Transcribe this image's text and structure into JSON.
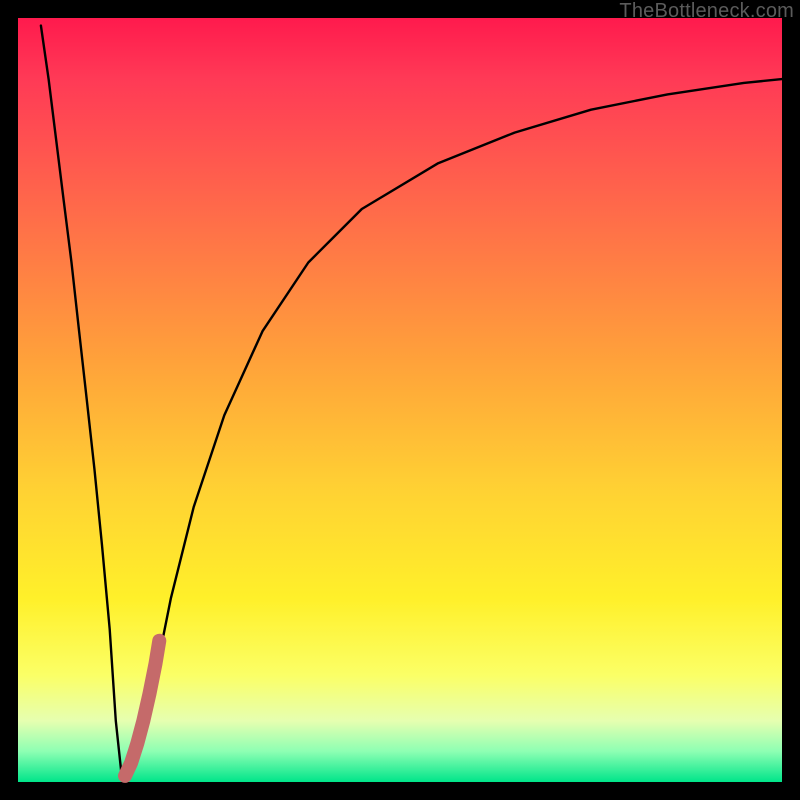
{
  "watermark": "TheBottleneck.com",
  "chart_data": {
    "type": "line",
    "title": "",
    "xlabel": "",
    "ylabel": "",
    "xlim": [
      0,
      100
    ],
    "ylim": [
      0,
      100
    ],
    "series": [
      {
        "name": "bottleneck-curve",
        "color": "#000000",
        "x": [
          3,
          4,
          5,
          6,
          7,
          8,
          9,
          10,
          11,
          12,
          12.8,
          13.5,
          14,
          15,
          16,
          18,
          20,
          23,
          27,
          32,
          38,
          45,
          55,
          65,
          75,
          85,
          95,
          100
        ],
        "y": [
          99,
          92,
          84,
          76,
          68,
          59,
          50,
          41,
          31,
          20,
          8,
          1.5,
          0.5,
          2,
          6,
          14,
          24,
          36,
          48,
          59,
          68,
          75,
          81,
          85,
          88,
          90,
          91.5,
          92
        ]
      },
      {
        "name": "highlight-segment",
        "color": "#c56a6a",
        "x": [
          14.0,
          14.8,
          15.6,
          16.4,
          17.2,
          18.0,
          18.5
        ],
        "y": [
          0.8,
          2.5,
          5.0,
          8.0,
          11.5,
          15.5,
          18.5
        ]
      }
    ]
  }
}
